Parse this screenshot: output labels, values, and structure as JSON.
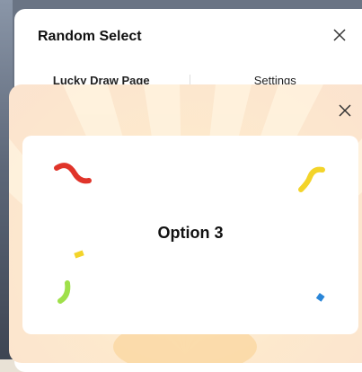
{
  "dialog": {
    "title": "Random Select",
    "close_icon": "close-icon"
  },
  "tabs": [
    {
      "label": "Lucky Draw Page",
      "active": true
    },
    {
      "label": "Settings",
      "active": false
    }
  ],
  "result": {
    "text": "Option 3",
    "close_icon": "close-icon"
  },
  "colors": {
    "confetti_red": "#e0342a",
    "confetti_yellow": "#f3d42a",
    "confetti_green": "#9fe04a",
    "confetti_blue": "#2a86d8",
    "overlay_glow": "#fde9cd"
  }
}
